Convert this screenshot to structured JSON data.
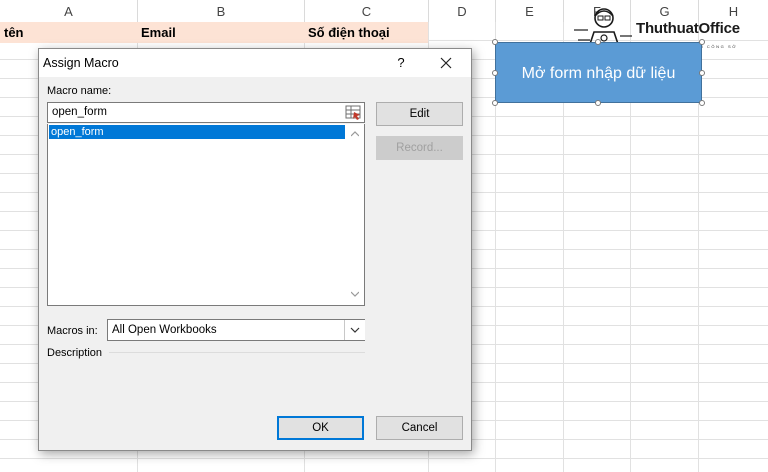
{
  "sheet": {
    "columns": [
      "A",
      "B",
      "C",
      "D",
      "E",
      "F",
      "G",
      "H"
    ],
    "header_row": {
      "col_a": "tên",
      "col_b": "Email",
      "col_c": "Số điện thoại"
    },
    "header_fill_color": "#fde3d5"
  },
  "macro_shape": {
    "label": "Mở form nhập dữ liệu",
    "fill_color": "#5b9bd5"
  },
  "watermark": {
    "name": "ThuthuatOffice",
    "tagline": "TRI KỶ CỦA DÂN CÔNG SỞ"
  },
  "dialog": {
    "title": "Assign Macro",
    "help_label": "?",
    "close_icon": "close-icon",
    "macro_name_label": "Macro name:",
    "macro_name_value": "open_form",
    "macro_list": [
      "open_form"
    ],
    "macros_in_label": "Macros in:",
    "macros_in_value": "All Open Workbooks",
    "description_label": "Description",
    "buttons": {
      "edit": "Edit",
      "record": "Record...",
      "ok": "OK",
      "cancel": "Cancel"
    },
    "selection_color": "#0078d7"
  }
}
